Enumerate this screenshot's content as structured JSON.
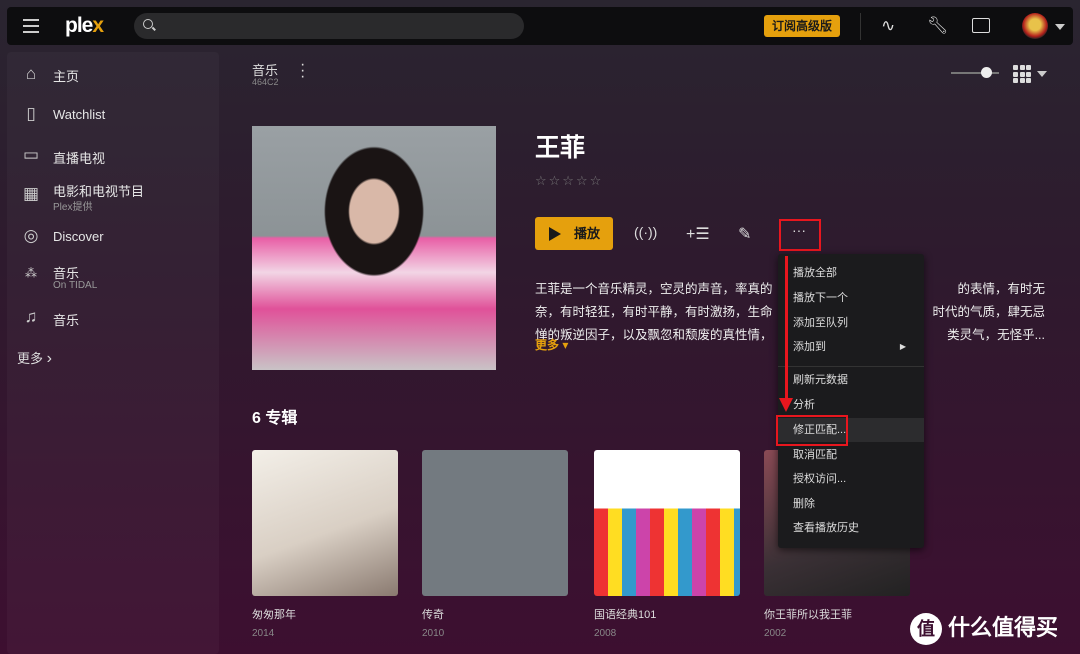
{
  "topbar": {
    "logo_text": "plex",
    "logo_accent": "x",
    "search_placeholder": "",
    "premium_label": "订阅高级版",
    "icons": [
      "activity-icon",
      "wrench-icon",
      "cast-icon"
    ]
  },
  "sidebar": {
    "items": [
      {
        "label": "主页",
        "icon": "home-icon"
      },
      {
        "label": "Watchlist",
        "icon": "bookmark-icon"
      },
      {
        "label": "直播电视",
        "icon": "tv-icon"
      },
      {
        "label": "电影和电视节目",
        "sub": "Plex提供",
        "icon": "film-icon"
      },
      {
        "label": "Discover",
        "icon": "compass-icon"
      },
      {
        "label": "音乐",
        "sub": "On TIDAL",
        "icon": "tidal-icon"
      },
      {
        "label": "音乐",
        "icon": "music-note-icon"
      }
    ],
    "more_label": "更多"
  },
  "library": {
    "title": "音乐",
    "subtitle": "464C2"
  },
  "artist": {
    "name": "王菲",
    "rating_stars": 0,
    "rating_max": 5,
    "play_label": "播放",
    "description_lines": [
      [
        "王菲是一个音乐精灵，空灵的声音，率真的",
        "的表情，有时无"
      ],
      [
        "奈，有时轻狂，有时平静，有时激扬，生命",
        "时代的气质，肆无忌"
      ],
      [
        "惮的叛逆因子，以及飘忽和颓废的真性情，",
        "类灵气，无怪乎..."
      ]
    ],
    "more_label": "更多"
  },
  "albums": {
    "heading": "6 专辑",
    "items": [
      {
        "title": "匆匆那年",
        "year": "2014"
      },
      {
        "title": "传奇",
        "year": "2010"
      },
      {
        "title": "国语经典101",
        "year": "2008"
      },
      {
        "title": "你王菲所以我王菲",
        "year": "2002"
      }
    ]
  },
  "context_menu": {
    "items": [
      "播放全部",
      "播放下一个",
      "添加至队列",
      "添加到",
      "刷新元数据",
      "分析",
      "修正匹配...",
      "取消匹配",
      "授权访问...",
      "删除",
      "查看播放历史"
    ],
    "highlighted": "修正匹配..."
  },
  "watermark": {
    "badge": "值",
    "text": "什么值得买"
  },
  "colors": {
    "accent": "#e5a00d",
    "annotation": "#e8161e"
  }
}
